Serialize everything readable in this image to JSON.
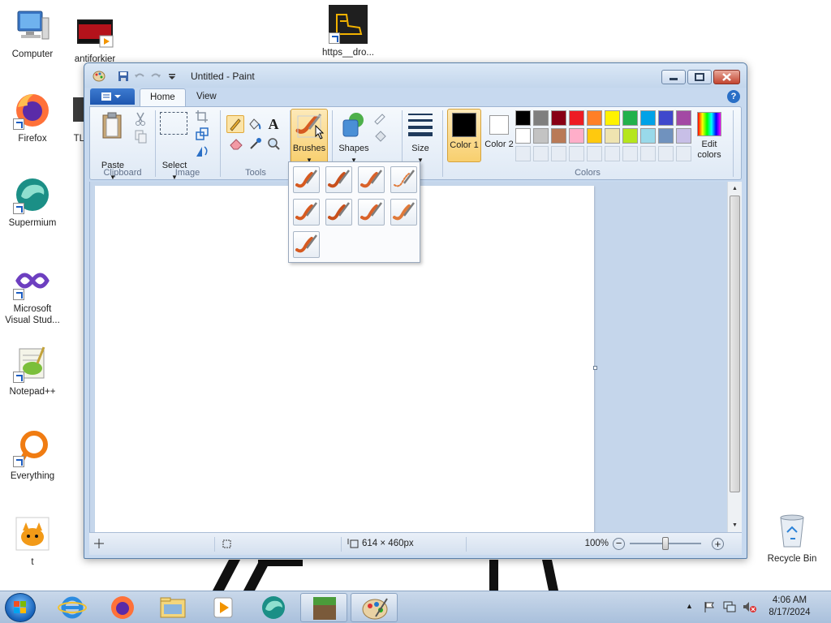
{
  "desktop": {
    "icons": [
      {
        "label": "Computer"
      },
      {
        "label": "antiforkier"
      },
      {
        "label": "https__dro..."
      },
      {
        "label": "Firefox"
      },
      {
        "label": "TL"
      },
      {
        "label": "Supermium"
      },
      {
        "label": "Microsoft Visual Stud..."
      },
      {
        "label": "Notepad++"
      },
      {
        "label": "Everything"
      },
      {
        "label": "t"
      },
      {
        "label": "Recycle Bin"
      }
    ]
  },
  "window": {
    "title": "Untitled - Paint",
    "tabs": [
      {
        "label": "Home",
        "active": true
      },
      {
        "label": "View",
        "active": false
      }
    ],
    "ribbon": {
      "clipboard": {
        "group_label": "Clipboard",
        "paste_label": "Paste"
      },
      "image": {
        "group_label": "Image",
        "select_label": "Select"
      },
      "tools": {
        "group_label": "Tools"
      },
      "brushes_label": "Brushes",
      "shapes_label": "Shapes",
      "size_label": "Size",
      "colors": {
        "group_label": "Colors",
        "color1_label": "Color 1",
        "color2_label": "Color 2",
        "color1_value": "#000000",
        "color2_value": "#ffffff",
        "edit_colors_label": "Edit colors",
        "palette_row1": [
          "#000000",
          "#7f7f7f",
          "#880015",
          "#ed1c24",
          "#ff7f27",
          "#fff200",
          "#22b14c",
          "#00a2e8",
          "#3f48cc",
          "#a349a4"
        ],
        "palette_row2": [
          "#ffffff",
          "#c3c3c3",
          "#b97a57",
          "#ffaec9",
          "#ffc90e",
          "#efe4b0",
          "#b5e61d",
          "#99d9ea",
          "#7092be",
          "#c8bfe7"
        ]
      }
    },
    "brushes_menu": {
      "items": [
        "brush",
        "calligraphy-brush-1",
        "calligraphy-brush-2",
        "airbrush",
        "oil-brush",
        "crayon",
        "marker",
        "natural-pencil",
        "watercolor-brush"
      ]
    },
    "status": {
      "canvas_size": "614 × 460px",
      "zoom": "100%"
    }
  },
  "taskbar": {
    "time": "4:06 AM",
    "date": "8/17/2024"
  }
}
